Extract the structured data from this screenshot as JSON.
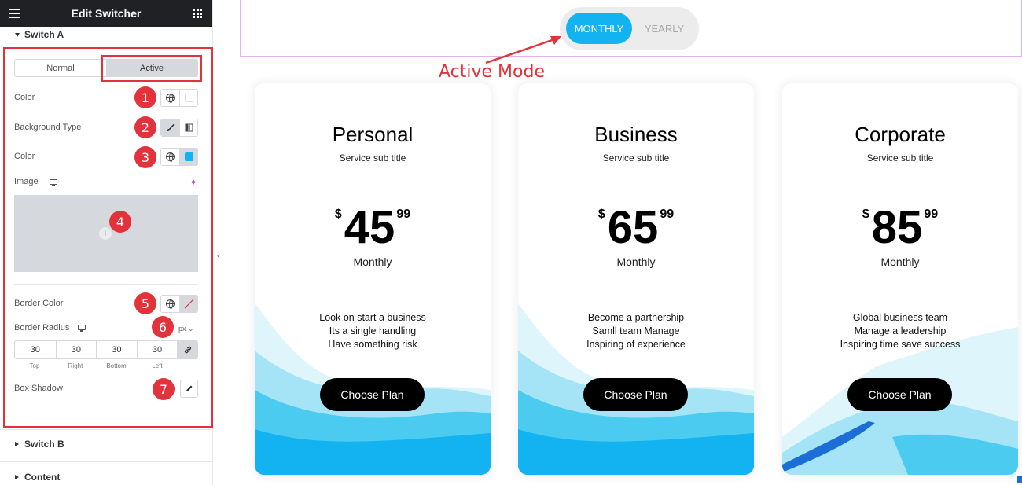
{
  "panel": {
    "title": "Edit Switcher",
    "section_a": "Switch A",
    "section_b": "Switch B",
    "section_content": "Content",
    "tabs": [
      "Normal",
      "Active"
    ],
    "labels": {
      "color1": "Color",
      "bg_type": "Background Type",
      "color2": "Color",
      "image": "Image",
      "border_color": "Border Color",
      "border_radius": "Border Radius",
      "box_shadow": "Box Shadow"
    },
    "units": "px ⌄",
    "radius": {
      "values": [
        "30",
        "30",
        "30",
        "30"
      ],
      "labels": [
        "Top",
        "Right",
        "Bottom",
        "Left"
      ]
    },
    "badges": [
      "1",
      "2",
      "3",
      "4",
      "5",
      "6",
      "7"
    ]
  },
  "preview": {
    "switcher": {
      "on": "MONTHLY",
      "off": "YEARLY"
    },
    "annotation": "Active Mode",
    "cards": [
      {
        "name": "Personal",
        "sub": "Service sub title",
        "currency": "$",
        "amount": "45",
        "cents": "99",
        "period": "Monthly",
        "features": [
          "Look on start a business",
          "Its a single handling",
          "Have something risk"
        ],
        "button": "Choose Plan"
      },
      {
        "name": "Business",
        "sub": "Service sub title",
        "currency": "$",
        "amount": "65",
        "cents": "99",
        "period": "Monthly",
        "features": [
          "Become a partnership",
          "Samll team Manage",
          "Inspiring of experience"
        ],
        "button": "Choose Plan"
      },
      {
        "name": "Corporate",
        "sub": "Service sub title",
        "currency": "$",
        "amount": "85",
        "cents": "99",
        "period": "Monthly",
        "features": [
          "Global business team",
          "Manage a leadership",
          "Inspiring time save success"
        ],
        "button": "Choose Plan"
      }
    ]
  },
  "colors": {
    "accent_red": "#e2333d",
    "switch_blue": "#12b3f0",
    "panel_dark": "#1f2124"
  }
}
